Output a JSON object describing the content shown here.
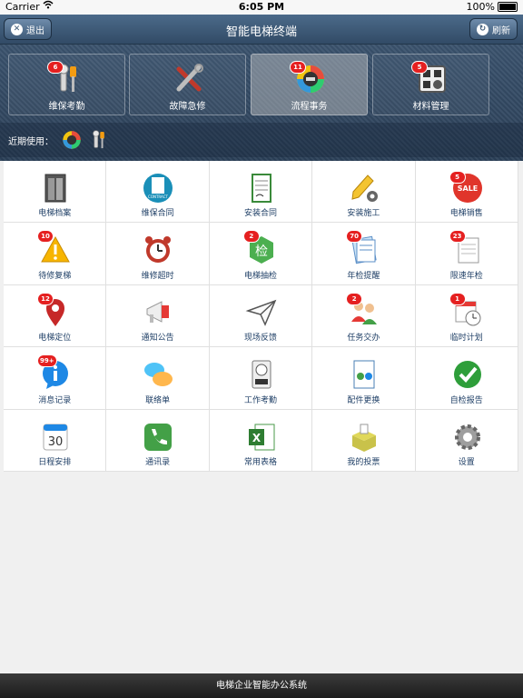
{
  "status": {
    "carrier": "Carrier",
    "time": "6:05 PM",
    "battery": "100%"
  },
  "topbar": {
    "title": "智能电梯终端",
    "logout": "退出",
    "refresh": "刷新"
  },
  "categories": [
    {
      "label": "维保考勤",
      "badge": "6",
      "icon": "tools-icon"
    },
    {
      "label": "故障急修",
      "badge": "",
      "icon": "wrench-screwdriver-icon"
    },
    {
      "label": "流程事务",
      "badge": "11",
      "icon": "process-wheel-icon"
    },
    {
      "label": "材料管理",
      "badge": "5",
      "icon": "material-box-icon"
    }
  ],
  "recent": {
    "label": "近期使用："
  },
  "grid": [
    {
      "name": "电梯档案",
      "badge": "",
      "icon": "elevator-icon"
    },
    {
      "name": "维保合同",
      "badge": "",
      "icon": "contract-icon"
    },
    {
      "name": "安装合同",
      "badge": "",
      "icon": "document-icon"
    },
    {
      "name": "安装施工",
      "badge": "",
      "icon": "pencil-gear-icon"
    },
    {
      "name": "电梯销售",
      "badge": "5",
      "icon": "sale-icon"
    },
    {
      "name": "待修复梯",
      "badge": "10",
      "icon": "warning-icon"
    },
    {
      "name": "维修超时",
      "badge": "",
      "icon": "alarm-clock-icon"
    },
    {
      "name": "电梯抽检",
      "badge": "2",
      "icon": "inspect-icon"
    },
    {
      "name": "年检提醒",
      "badge": "70",
      "icon": "notes-icon"
    },
    {
      "name": "限速年检",
      "badge": "23",
      "icon": "notepad-icon"
    },
    {
      "name": "电梯定位",
      "badge": "12",
      "icon": "map-pin-icon"
    },
    {
      "name": "通知公告",
      "badge": "",
      "icon": "megaphone-icon"
    },
    {
      "name": "现场反馈",
      "badge": "",
      "icon": "paper-plane-icon"
    },
    {
      "name": "任务交办",
      "badge": "2",
      "icon": "people-icon"
    },
    {
      "name": "临时计划",
      "badge": "1",
      "icon": "calendar-clock-icon"
    },
    {
      "name": "消息记录",
      "badge": "99+",
      "icon": "info-bubble-icon"
    },
    {
      "name": "联络单",
      "badge": "",
      "icon": "chat-bubbles-icon"
    },
    {
      "name": "工作考勤",
      "badge": "",
      "icon": "time-clock-icon"
    },
    {
      "name": "配件更换",
      "badge": "",
      "icon": "file-exchange-icon"
    },
    {
      "name": "自检报告",
      "badge": "",
      "icon": "checkmark-icon"
    },
    {
      "name": "日程安排",
      "badge": "",
      "icon": "calendar-icon",
      "day": "30"
    },
    {
      "name": "通讯录",
      "badge": "",
      "icon": "phone-icon"
    },
    {
      "name": "常用表格",
      "badge": "",
      "icon": "excel-icon"
    },
    {
      "name": "我的投票",
      "badge": "",
      "icon": "ballot-box-icon"
    },
    {
      "name": "设置",
      "badge": "",
      "icon": "settings-gear-icon"
    }
  ],
  "footer": {
    "text": "电梯企业智能办公系统"
  }
}
